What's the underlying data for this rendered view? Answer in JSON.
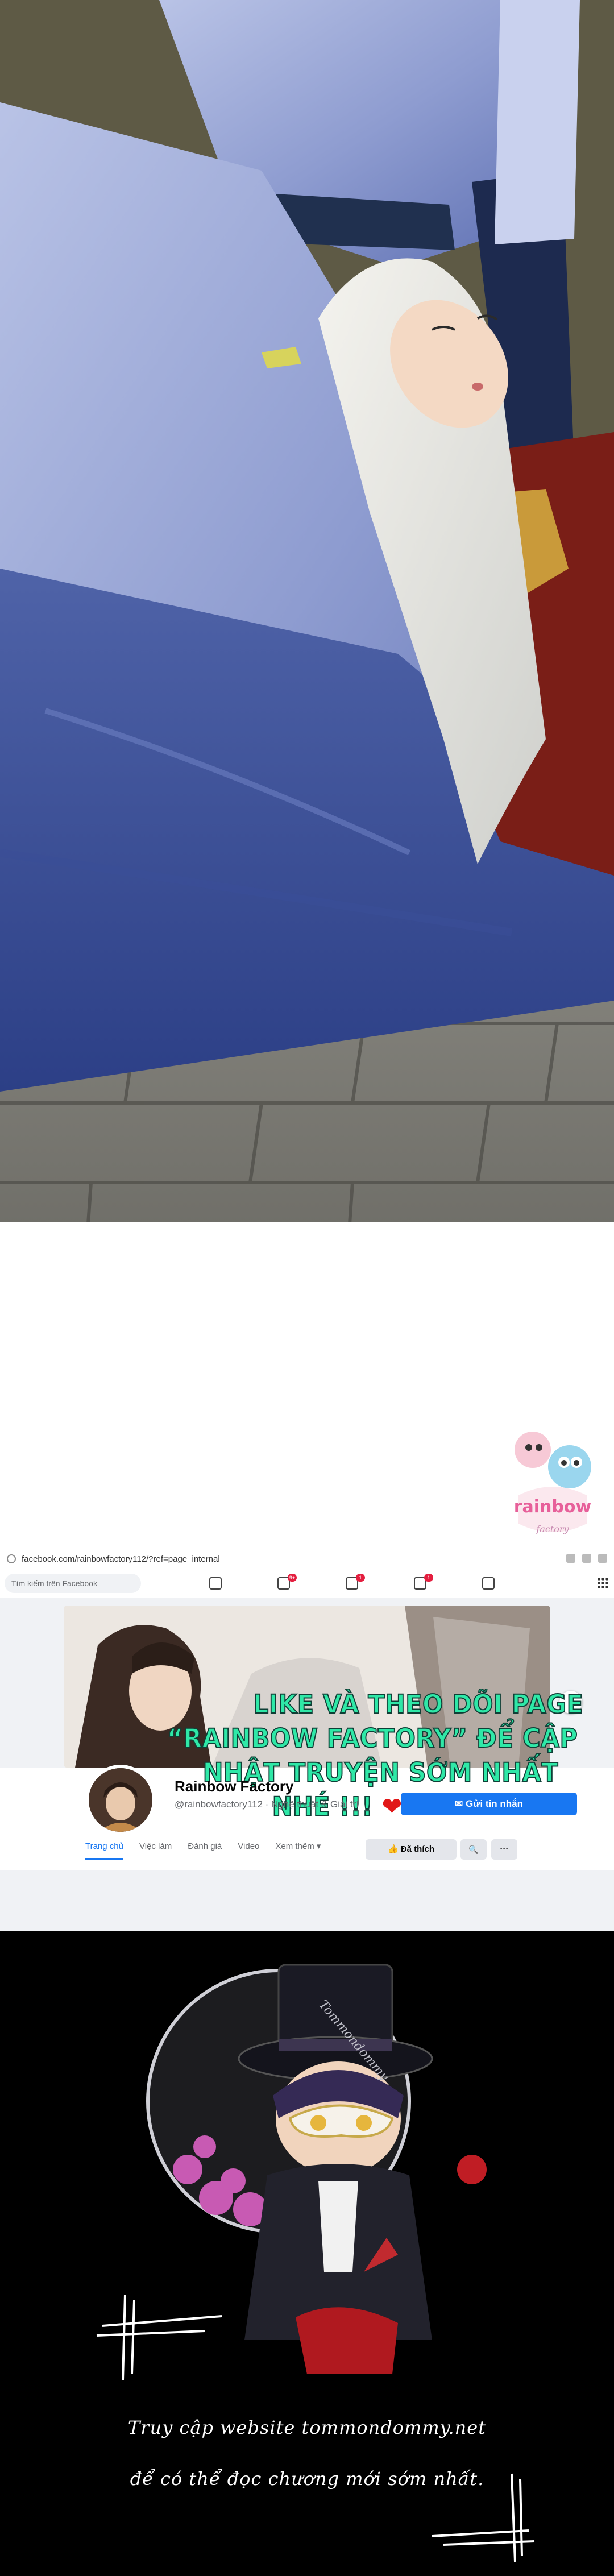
{
  "facebook": {
    "url": "facebook.com/rainbowfactory112/?ref=page_internal",
    "search_placeholder": "Tìm kiếm trên Facebook",
    "badges": [
      "9+",
      "1",
      "1"
    ],
    "page_name": "Rainbow Factory",
    "page_handle": "@rainbowfactory112 · Nghệ thuật & Giải trí",
    "message_button": "Gửi tin nhắn",
    "tabs": [
      "Trang chủ",
      "Việc làm",
      "Đánh giá",
      "Video",
      "Xem thêm ▾"
    ],
    "liked_button": "Đã thích",
    "search_button": "🔍",
    "more_button": "···",
    "next_arrow": "›"
  },
  "promo": {
    "line1": "LIKE VÀ THEO DÕI PAGE",
    "line2": "“RAINBOW FACTORY” ĐỂ CẬP",
    "line3": "NHẬT TRUYỆN SỚM NHẤT",
    "line4": "NHÉ !!!",
    "heart": "❤"
  },
  "watermark": {
    "logo_text": "rainbow",
    "badge_text": "Tommondommy"
  },
  "outro": {
    "line1": "Truy cập website tommondommy.net",
    "line2": "để có thể đọc chương mới sớm nhất."
  },
  "colors": {
    "promo_text": "#2fe8a7",
    "facebook_blue": "#1877f2",
    "heart": "#e11717"
  }
}
